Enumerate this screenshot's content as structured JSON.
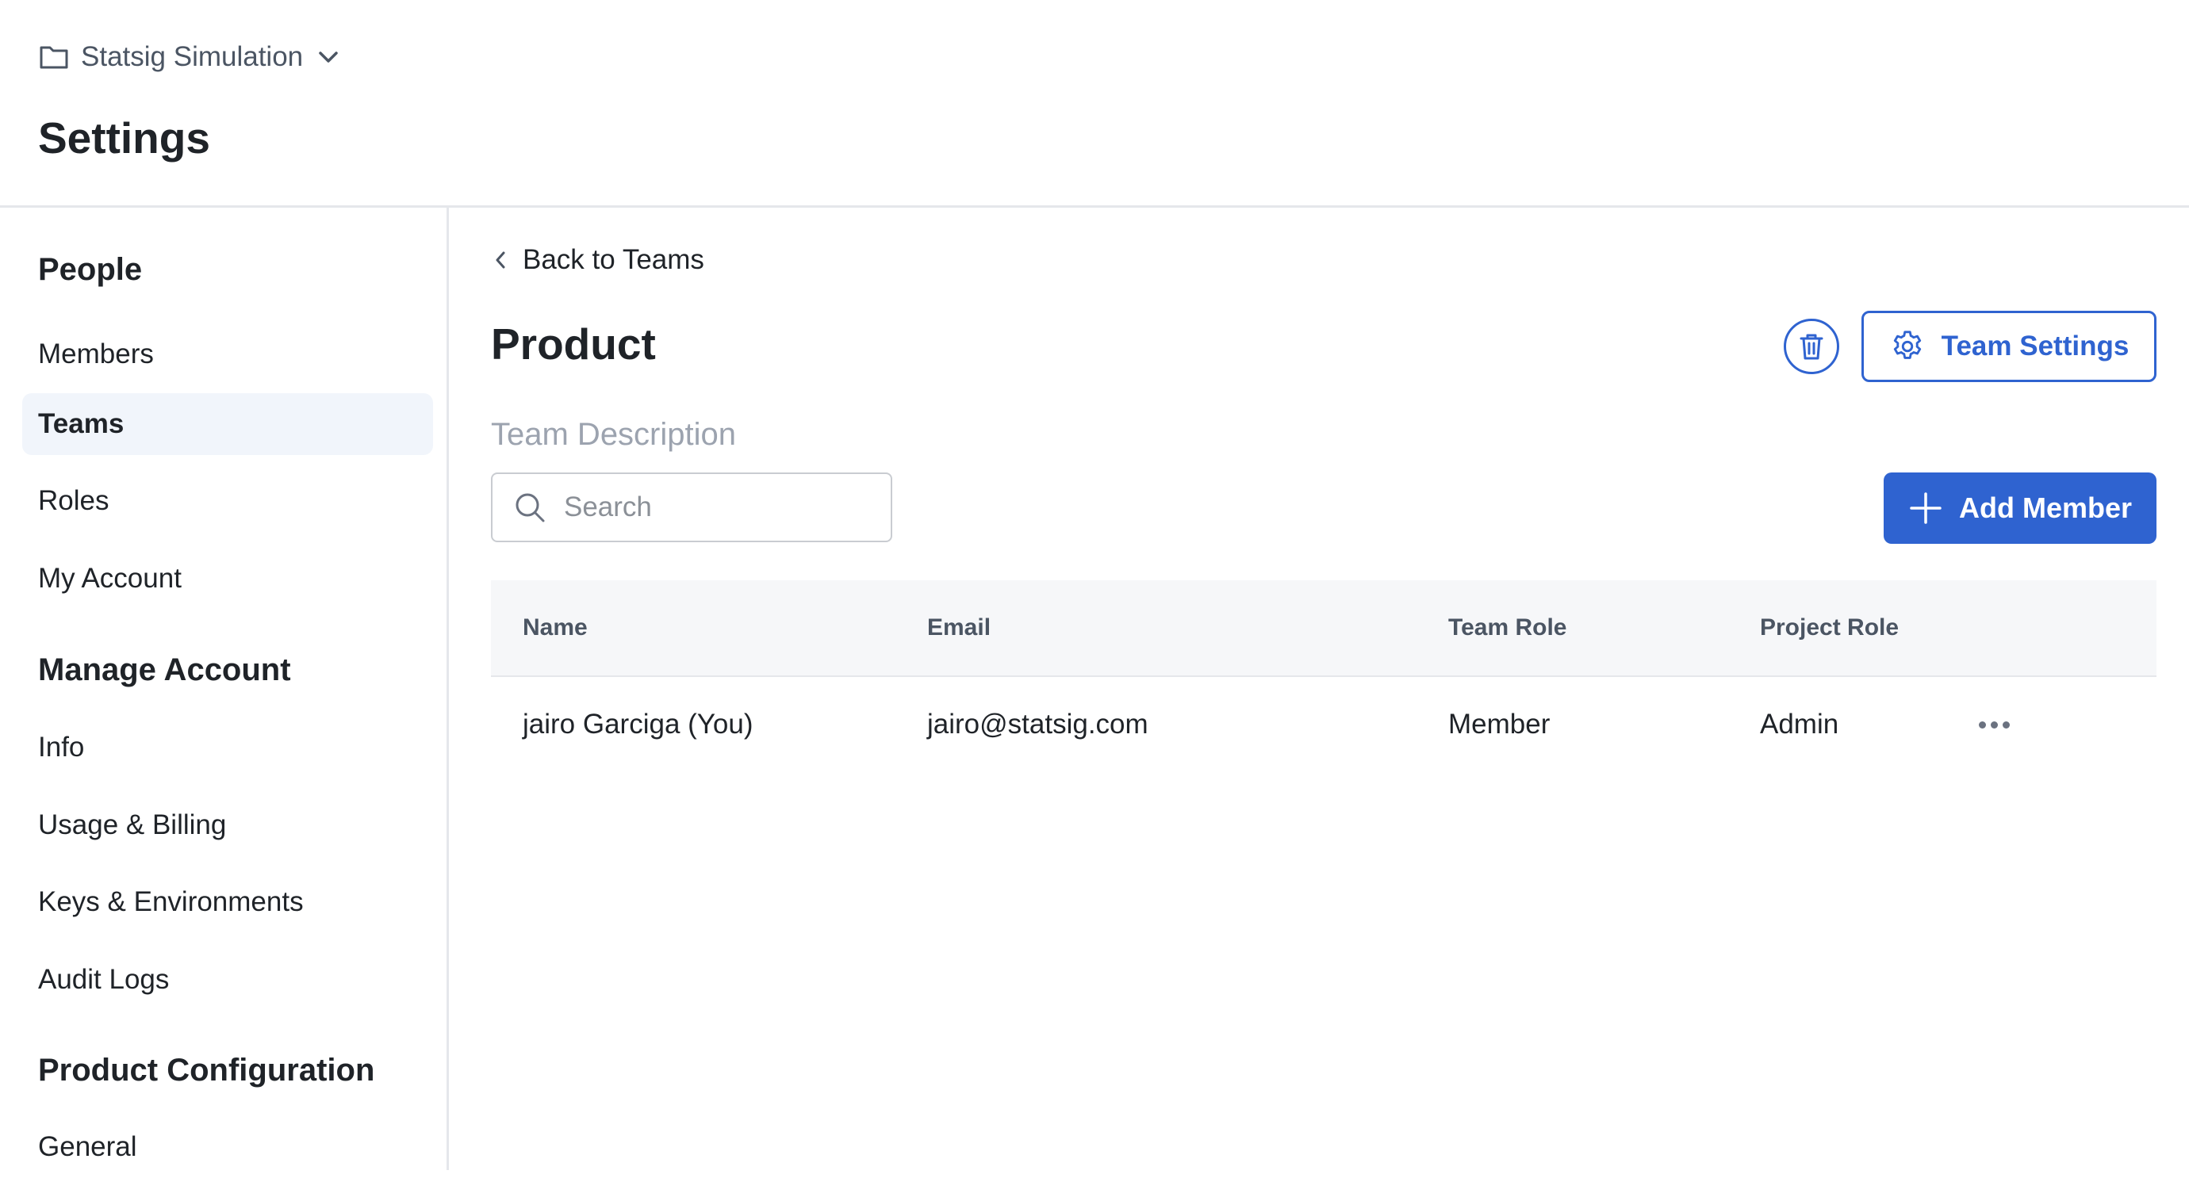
{
  "header": {
    "project_name": "Statsig Simulation",
    "page_title": "Settings"
  },
  "sidebar": {
    "sections": [
      {
        "title": "People"
      },
      {
        "title": "Manage Account"
      },
      {
        "title": "Product Configuration"
      }
    ],
    "items": [
      {
        "label": "Members"
      },
      {
        "label": "Teams",
        "active": true
      },
      {
        "label": "Roles"
      },
      {
        "label": "My Account"
      },
      {
        "label": "Info"
      },
      {
        "label": "Usage & Billing"
      },
      {
        "label": "Keys & Environments"
      },
      {
        "label": "Audit Logs"
      },
      {
        "label": "General"
      }
    ]
  },
  "main": {
    "back_label": "Back to Teams",
    "team_name": "Product",
    "team_settings_label": "Team Settings",
    "team_description_placeholder": "Team Description",
    "search_placeholder": "Search",
    "add_member_label": "Add Member",
    "table": {
      "columns": [
        "Name",
        "Email",
        "Team Role",
        "Project Role"
      ],
      "rows": [
        {
          "name": "jairo Garciga (You)",
          "email": "jairo@statsig.com",
          "team_role": "Member",
          "project_role": "Admin"
        }
      ]
    }
  },
  "colors": {
    "accent": "#2f63d0",
    "active_nav_bg": "#f1f5fb",
    "table_header_bg": "#f6f7f9"
  }
}
